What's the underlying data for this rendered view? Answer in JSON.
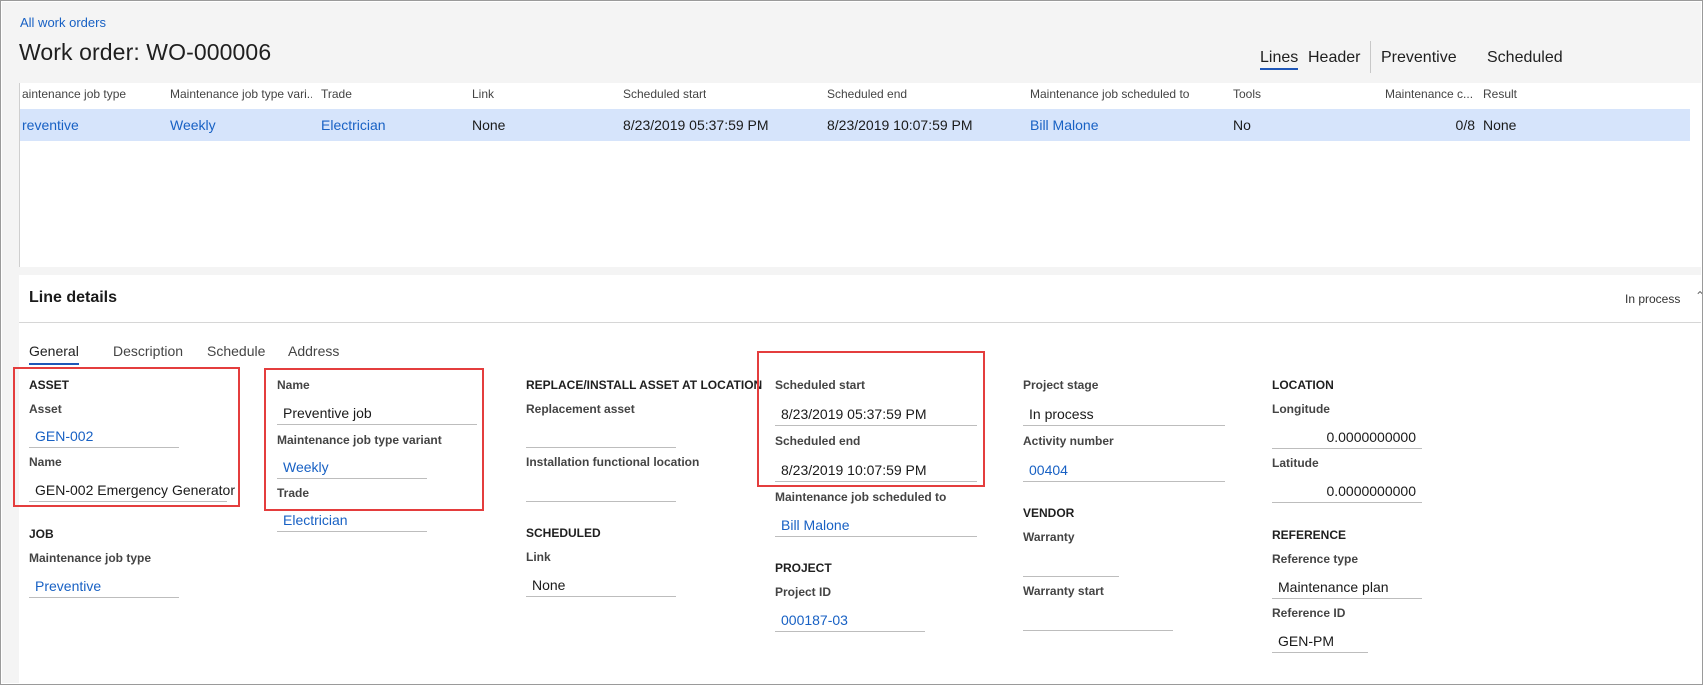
{
  "breadcrumb": "All work orders",
  "page_title": "Work order: WO-000006",
  "top_tabs": [
    "Lines",
    "Header",
    "Preventive",
    "Scheduled"
  ],
  "grid": {
    "columns": [
      "aintenance job type",
      "Maintenance job type vari...",
      "Trade",
      "Link",
      "Scheduled start",
      "Scheduled end",
      "Maintenance job scheduled to",
      "Tools",
      "Maintenance c...",
      "Result"
    ],
    "row": [
      "reventive",
      "Weekly",
      "Electrician",
      "None",
      "8/23/2019 05:37:59 PM",
      "8/23/2019 10:07:59 PM",
      "Bill Malone",
      "No",
      "0/8",
      "None"
    ]
  },
  "line_details": {
    "title": "Line details",
    "status": "In process",
    "tabs": [
      "General",
      "Description",
      "Schedule",
      "Address"
    ]
  },
  "fields": {
    "asset_section": "ASSET",
    "asset_label": "Asset",
    "asset_value": "GEN-002",
    "asset_name_label": "Name",
    "asset_name_value": "GEN-002 Emergency Generator",
    "job_section": "JOB",
    "job_type_label": "Maintenance job type",
    "job_type_value": "Preventive",
    "name_label": "Name",
    "name_value": "Preventive job",
    "variant_label": "Maintenance job type variant",
    "variant_value": "Weekly",
    "trade_label": "Trade",
    "trade_value": "Electrician",
    "replace_section": "REPLACE/INSTALL ASSET AT LOCATION",
    "replacement_label": "Replacement asset",
    "replacement_value": "",
    "install_label": "Installation functional location",
    "install_value": "",
    "scheduled_section": "SCHEDULED",
    "link_label": "Link",
    "link_value": "None",
    "sched_start_label": "Scheduled start",
    "sched_start_value": "8/23/2019 05:37:59 PM",
    "sched_end_label": "Scheduled end",
    "sched_end_value": "8/23/2019 10:07:59 PM",
    "sched_to_label": "Maintenance job scheduled to",
    "sched_to_value": "Bill Malone",
    "project_section": "PROJECT",
    "project_id_label": "Project ID",
    "project_id_value": "000187-03",
    "project_stage_label": "Project stage",
    "project_stage_value": "In process",
    "activity_label": "Activity number",
    "activity_value": "00404",
    "vendor_section": "VENDOR",
    "warranty_label": "Warranty",
    "warranty_value": "",
    "warranty_start_label": "Warranty start",
    "warranty_start_value": "",
    "location_section": "LOCATION",
    "longitude_label": "Longitude",
    "longitude_value": "0.0000000000",
    "latitude_label": "Latitude",
    "latitude_value": "0.0000000000",
    "reference_section": "REFERENCE",
    "ref_type_label": "Reference type",
    "ref_type_value": "Maintenance plan",
    "ref_id_label": "Reference ID",
    "ref_id_value": "GEN-PM"
  },
  "colors": {
    "link": "#1861c4",
    "selected_row": "#d6e4fb",
    "highlight_box": "#e43d3d",
    "tab_underline": "#1f57b8"
  }
}
